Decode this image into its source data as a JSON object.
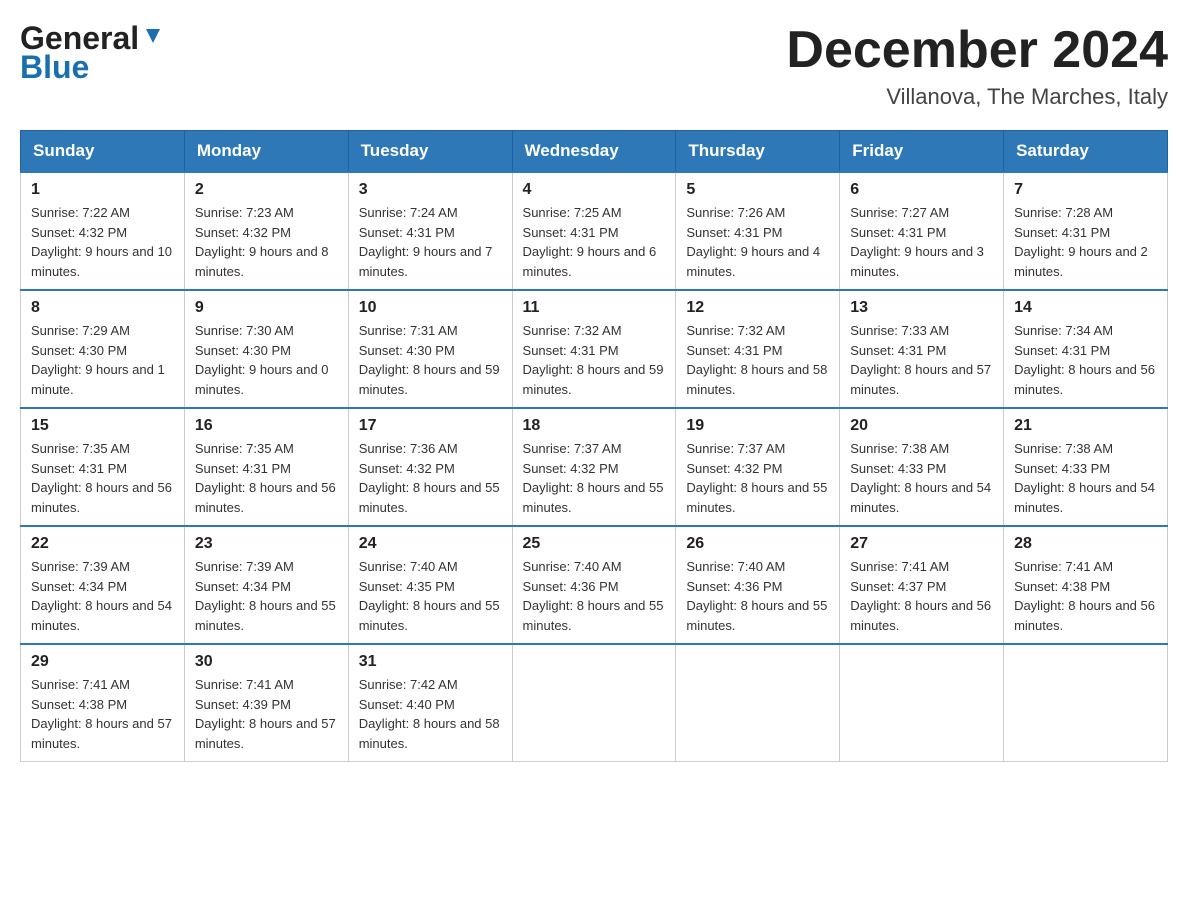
{
  "header": {
    "logo_general": "General",
    "logo_blue": "Blue",
    "title": "December 2024",
    "subtitle": "Villanova, The Marches, Italy"
  },
  "days_of_week": [
    "Sunday",
    "Monday",
    "Tuesday",
    "Wednesday",
    "Thursday",
    "Friday",
    "Saturday"
  ],
  "weeks": [
    [
      {
        "day": "1",
        "sunrise": "7:22 AM",
        "sunset": "4:32 PM",
        "daylight": "9 hours and 10 minutes."
      },
      {
        "day": "2",
        "sunrise": "7:23 AM",
        "sunset": "4:32 PM",
        "daylight": "9 hours and 8 minutes."
      },
      {
        "day": "3",
        "sunrise": "7:24 AM",
        "sunset": "4:31 PM",
        "daylight": "9 hours and 7 minutes."
      },
      {
        "day": "4",
        "sunrise": "7:25 AM",
        "sunset": "4:31 PM",
        "daylight": "9 hours and 6 minutes."
      },
      {
        "day": "5",
        "sunrise": "7:26 AM",
        "sunset": "4:31 PM",
        "daylight": "9 hours and 4 minutes."
      },
      {
        "day": "6",
        "sunrise": "7:27 AM",
        "sunset": "4:31 PM",
        "daylight": "9 hours and 3 minutes."
      },
      {
        "day": "7",
        "sunrise": "7:28 AM",
        "sunset": "4:31 PM",
        "daylight": "9 hours and 2 minutes."
      }
    ],
    [
      {
        "day": "8",
        "sunrise": "7:29 AM",
        "sunset": "4:30 PM",
        "daylight": "9 hours and 1 minute."
      },
      {
        "day": "9",
        "sunrise": "7:30 AM",
        "sunset": "4:30 PM",
        "daylight": "9 hours and 0 minutes."
      },
      {
        "day": "10",
        "sunrise": "7:31 AM",
        "sunset": "4:30 PM",
        "daylight": "8 hours and 59 minutes."
      },
      {
        "day": "11",
        "sunrise": "7:32 AM",
        "sunset": "4:31 PM",
        "daylight": "8 hours and 59 minutes."
      },
      {
        "day": "12",
        "sunrise": "7:32 AM",
        "sunset": "4:31 PM",
        "daylight": "8 hours and 58 minutes."
      },
      {
        "day": "13",
        "sunrise": "7:33 AM",
        "sunset": "4:31 PM",
        "daylight": "8 hours and 57 minutes."
      },
      {
        "day": "14",
        "sunrise": "7:34 AM",
        "sunset": "4:31 PM",
        "daylight": "8 hours and 56 minutes."
      }
    ],
    [
      {
        "day": "15",
        "sunrise": "7:35 AM",
        "sunset": "4:31 PM",
        "daylight": "8 hours and 56 minutes."
      },
      {
        "day": "16",
        "sunrise": "7:35 AM",
        "sunset": "4:31 PM",
        "daylight": "8 hours and 56 minutes."
      },
      {
        "day": "17",
        "sunrise": "7:36 AM",
        "sunset": "4:32 PM",
        "daylight": "8 hours and 55 minutes."
      },
      {
        "day": "18",
        "sunrise": "7:37 AM",
        "sunset": "4:32 PM",
        "daylight": "8 hours and 55 minutes."
      },
      {
        "day": "19",
        "sunrise": "7:37 AM",
        "sunset": "4:32 PM",
        "daylight": "8 hours and 55 minutes."
      },
      {
        "day": "20",
        "sunrise": "7:38 AM",
        "sunset": "4:33 PM",
        "daylight": "8 hours and 54 minutes."
      },
      {
        "day": "21",
        "sunrise": "7:38 AM",
        "sunset": "4:33 PM",
        "daylight": "8 hours and 54 minutes."
      }
    ],
    [
      {
        "day": "22",
        "sunrise": "7:39 AM",
        "sunset": "4:34 PM",
        "daylight": "8 hours and 54 minutes."
      },
      {
        "day": "23",
        "sunrise": "7:39 AM",
        "sunset": "4:34 PM",
        "daylight": "8 hours and 55 minutes."
      },
      {
        "day": "24",
        "sunrise": "7:40 AM",
        "sunset": "4:35 PM",
        "daylight": "8 hours and 55 minutes."
      },
      {
        "day": "25",
        "sunrise": "7:40 AM",
        "sunset": "4:36 PM",
        "daylight": "8 hours and 55 minutes."
      },
      {
        "day": "26",
        "sunrise": "7:40 AM",
        "sunset": "4:36 PM",
        "daylight": "8 hours and 55 minutes."
      },
      {
        "day": "27",
        "sunrise": "7:41 AM",
        "sunset": "4:37 PM",
        "daylight": "8 hours and 56 minutes."
      },
      {
        "day": "28",
        "sunrise": "7:41 AM",
        "sunset": "4:38 PM",
        "daylight": "8 hours and 56 minutes."
      }
    ],
    [
      {
        "day": "29",
        "sunrise": "7:41 AM",
        "sunset": "4:38 PM",
        "daylight": "8 hours and 57 minutes."
      },
      {
        "day": "30",
        "sunrise": "7:41 AM",
        "sunset": "4:39 PM",
        "daylight": "8 hours and 57 minutes."
      },
      {
        "day": "31",
        "sunrise": "7:42 AM",
        "sunset": "4:40 PM",
        "daylight": "8 hours and 58 minutes."
      },
      null,
      null,
      null,
      null
    ]
  ],
  "labels": {
    "sunrise": "Sunrise:",
    "sunset": "Sunset:",
    "daylight": "Daylight:"
  }
}
